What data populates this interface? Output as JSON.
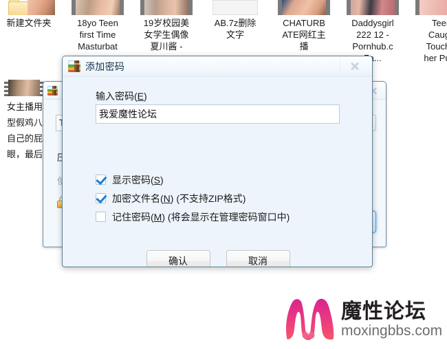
{
  "desktop": {
    "thumbnails": [
      {
        "label": "新建文件夹",
        "icon": "folder-icon",
        "kind": "folder"
      },
      {
        "label": "18yo Teen\nfirst Time\nMasturbat",
        "icon": "video-thumbnail-icon",
        "kind": "film"
      },
      {
        "label": "19岁校园美\n女学生偶像\n夏川酱 -",
        "icon": "video-thumbnail-icon",
        "kind": "film"
      },
      {
        "label": "AB.7z删除\n文字",
        "icon": "blank-file-icon",
        "kind": "blank"
      },
      {
        "label": "CHATURB\nATE网红主\n播",
        "icon": "video-thumbnail-icon",
        "kind": "film"
      },
      {
        "label": "Daddysgirl\n222 12 -\nPornhub.c\n7a...",
        "icon": "video-thumbnail-icon",
        "kind": "film"
      },
      {
        "label": "Teen\nCaugh\nTouchin\nher Puss",
        "icon": "video-thumbnail-icon",
        "kind": "film"
      }
    ],
    "left_note": {
      "icon": "video-thumbnail-icon",
      "text": "女主播用\n型假鸡八\n自己的屁\n眼，最后"
    }
  },
  "background_window": {
    "title": "",
    "icon": "winrar-icon",
    "close_icon": "close-icon",
    "field_value": "T",
    "browse_icon": "browse-icon",
    "label_a": "压",
    "label_b": "使",
    "lock_icon": "lock-icon",
    "focus_button_label": ""
  },
  "dialog": {
    "icon": "winrar-icon",
    "title": "添加密码",
    "close_icon": "close-icon",
    "password": {
      "label_prefix": "输入密码(",
      "label_accel": "E",
      "label_suffix": ")",
      "value": "我爱魔性论坛",
      "placeholder": ""
    },
    "checkboxes": [
      {
        "checked": true,
        "prefix": "显示密码(",
        "accel": "S",
        "suffix": ")",
        "hint": ""
      },
      {
        "checked": true,
        "prefix": "加密文件名(",
        "accel": "N",
        "suffix": ")",
        "hint": " (不支持ZIP格式)"
      },
      {
        "checked": false,
        "prefix": "记住密码(",
        "accel": "M",
        "suffix": ")",
        "hint": " (将会显示在管理密码窗口中)"
      }
    ],
    "buttons": {
      "ok": "确认",
      "cancel": "取消"
    }
  },
  "watermark": {
    "cn": "魔性论坛",
    "en": "moxingbbs.com",
    "logo_icon": "moxing-m-logo-icon",
    "accent_color": "#e8357f"
  }
}
